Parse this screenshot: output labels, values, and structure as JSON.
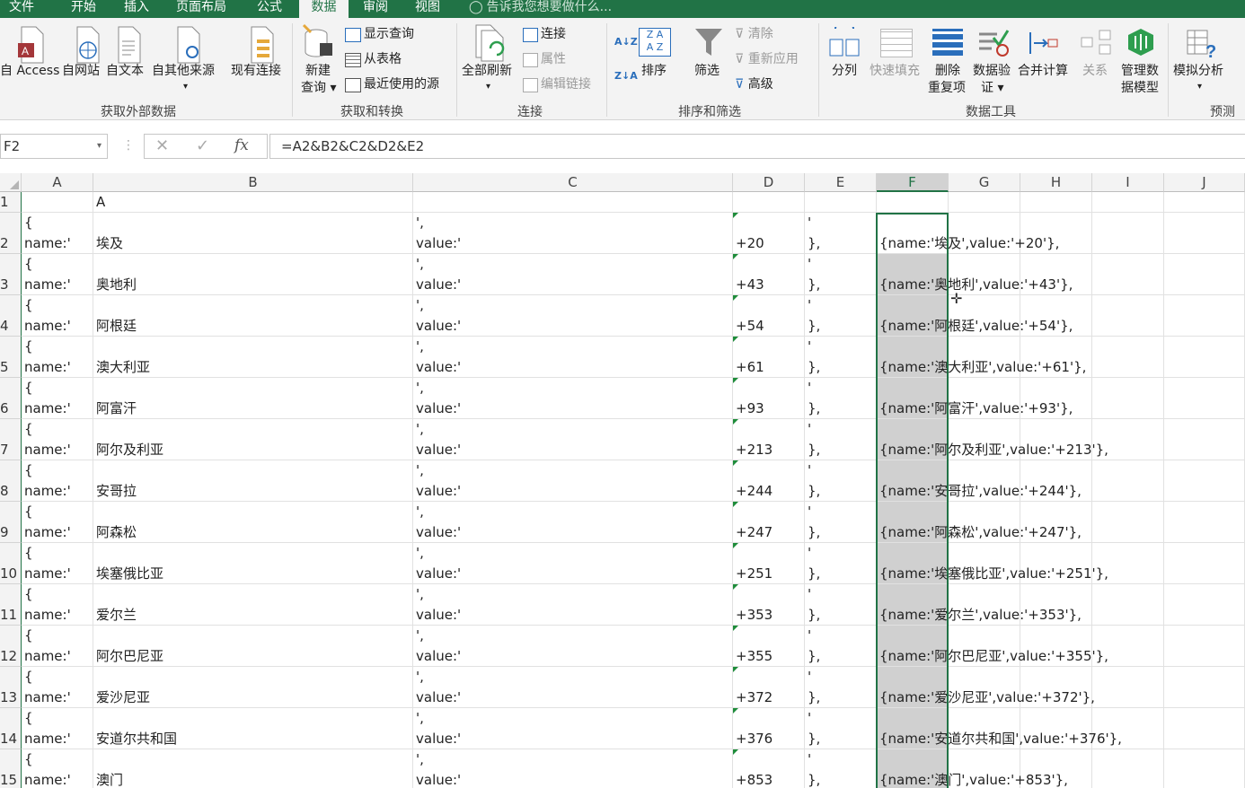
{
  "menu_tabs": [
    "文件",
    "开始",
    "插入",
    "页面布局",
    "公式",
    "数据",
    "审阅",
    "视图"
  ],
  "active_tab": "数据",
  "tell_me": "告诉我您想要做什么...",
  "ribbon": {
    "get_external": {
      "group_label": "获取外部数据",
      "access": "自 Access",
      "web": "自网站",
      "text": "自文本",
      "other": "自其他来源",
      "existing": "现有连接"
    },
    "get_transform": {
      "group_label": "获取和转换",
      "new_query_line1": "新建",
      "new_query_line2": "查询",
      "show_queries": "显示查询",
      "from_table": "从表格",
      "recent_sources": "最近使用的源"
    },
    "connections": {
      "group_label": "连接",
      "refresh_all": "全部刷新",
      "connections": "连接",
      "properties": "属性",
      "edit_links": "编辑链接"
    },
    "sort_filter": {
      "group_label": "排序和筛选",
      "sort": "排序",
      "filter": "筛选",
      "clear": "清除",
      "reapply": "重新应用",
      "advanced": "高级"
    },
    "data_tools": {
      "group_label": "数据工具",
      "text_to_columns": "分列",
      "flash_fill": "快速填充",
      "remove_dup_line1": "删除",
      "remove_dup_line2": "重复项",
      "validation_line1": "数据验",
      "validation_line2": "证",
      "consolidate": "合并计算",
      "relationships": "关系",
      "data_model_line1": "管理数",
      "data_model_line2": "据模型"
    },
    "forecast": {
      "group_label": "预测",
      "what_if": "模拟分析"
    }
  },
  "formula_bar": {
    "name_box": "F2",
    "formula": "=A2&B2&C2&D2&E2"
  },
  "columns": [
    "A",
    "B",
    "C",
    "D",
    "E",
    "F",
    "G",
    "H",
    "I",
    "J"
  ],
  "row1": {
    "num": "1",
    "b": "A"
  },
  "col_a": {
    "line1": "{",
    "line2": "name:'"
  },
  "col_c": {
    "line1": "',",
    "line2": "value:'"
  },
  "col_e": {
    "line1": "'",
    "line2": "},"
  },
  "rows": [
    {
      "num": "2",
      "b": "埃及",
      "d": "+20",
      "f": "{name:'埃及',value:'+20'},"
    },
    {
      "num": "3",
      "b": "奥地利",
      "d": "+43",
      "f": "{name:'奥地利',value:'+43'},"
    },
    {
      "num": "4",
      "b": "阿根廷",
      "d": "+54",
      "f": "{name:'阿根廷',value:'+54'},"
    },
    {
      "num": "5",
      "b": "澳大利亚",
      "d": "+61",
      "f": "{name:'澳大利亚',value:'+61'},"
    },
    {
      "num": "6",
      "b": "阿富汗",
      "d": "+93",
      "f": "{name:'阿富汗',value:'+93'},"
    },
    {
      "num": "7",
      "b": "阿尔及利亚",
      "d": "+213",
      "f": "{name:'阿尔及利亚',value:'+213'},"
    },
    {
      "num": "8",
      "b": "安哥拉",
      "d": "+244",
      "f": "{name:'安哥拉',value:'+244'},"
    },
    {
      "num": "9",
      "b": "阿森松",
      "d": "+247",
      "f": "{name:'阿森松',value:'+247'},"
    },
    {
      "num": "10",
      "b": "埃塞俄比亚",
      "d": "+251",
      "f": "{name:'埃塞俄比亚',value:'+251'},"
    },
    {
      "num": "11",
      "b": "爱尔兰",
      "d": "+353",
      "f": "{name:'爱尔兰',value:'+353'},"
    },
    {
      "num": "12",
      "b": "阿尔巴尼亚",
      "d": "+355",
      "f": "{name:'阿尔巴尼亚',value:'+355'},"
    },
    {
      "num": "13",
      "b": "爱沙尼亚",
      "d": "+372",
      "f": "{name:'爱沙尼亚',value:'+372'},"
    },
    {
      "num": "14",
      "b": "安道尔共和国",
      "d": "+376",
      "f": "{name:'安道尔共和国',value:'+376'},"
    },
    {
      "num": "15",
      "b": "澳门",
      "d": "+853",
      "f": "{name:'澳门',value:'+853'},"
    }
  ],
  "colors": {
    "accent": "#217346",
    "selection_fill": "#d0d0d0"
  }
}
